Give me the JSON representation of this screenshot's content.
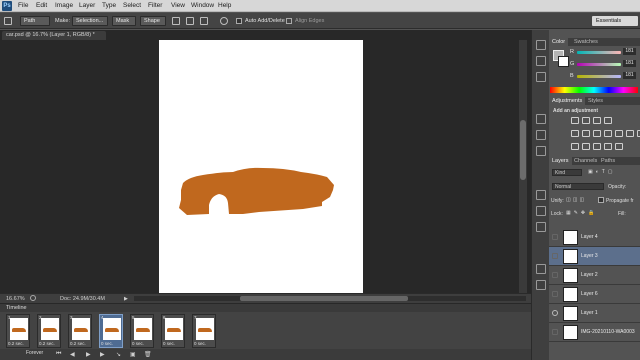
{
  "menubar": {
    "logo": "Ps",
    "items": [
      "File",
      "Edit",
      "Image",
      "Layer",
      "Type",
      "Select",
      "Filter",
      "View",
      "Window",
      "Help"
    ]
  },
  "options_bar": {
    "mode": "Path",
    "make_label": "Make:",
    "selection": "Selection...",
    "mask": "Mask",
    "shape": "Shape",
    "auto_add_delete": "Auto Add/Delete",
    "align_edges": "Align Edges",
    "workspace": "Essentials"
  },
  "document": {
    "tab_title": "car.psd @ 16.7% (Layer 1, RGB/8) *",
    "zoom": "16.67%",
    "doc_size": "Doc: 24.9M/30.4M"
  },
  "timeline": {
    "title": "Timeline",
    "frames": [
      {
        "num": "1",
        "duration": "0.2 sec."
      },
      {
        "num": "2",
        "duration": "0.2 sec."
      },
      {
        "num": "3",
        "duration": "0.2 sec."
      },
      {
        "num": "4",
        "duration": "0 sec."
      },
      {
        "num": "5",
        "duration": "0 sec."
      },
      {
        "num": "6",
        "duration": "0 sec."
      },
      {
        "num": "7",
        "duration": "0 sec."
      }
    ],
    "loop": "Forever"
  },
  "color_panel": {
    "tabs": [
      "Color",
      "Swatches"
    ],
    "channels": [
      {
        "label": "R",
        "value": "181"
      },
      {
        "label": "G",
        "value": "181"
      },
      {
        "label": "B",
        "value": "181"
      }
    ]
  },
  "adjustments_panel": {
    "tabs": [
      "Adjustments",
      "Styles"
    ],
    "heading": "Add an adjustment"
  },
  "layers_panel": {
    "tabs": [
      "Layers",
      "Channels",
      "Paths"
    ],
    "kind": "Kind",
    "blend_mode": "Normal",
    "opacity_label": "Opacity:",
    "lock_label": "Lock:",
    "fill_label": "Fill:",
    "unify_label": "Unify:",
    "propagate_label": "Propagate fr",
    "layers": [
      {
        "name": "Layer 4",
        "selected": false,
        "visible": false
      },
      {
        "name": "Layer 3",
        "selected": true,
        "visible": false
      },
      {
        "name": "Layer 2",
        "selected": false,
        "visible": false
      },
      {
        "name": "Layer 6",
        "selected": false,
        "visible": false
      },
      {
        "name": "Layer 1",
        "selected": false,
        "visible": true
      },
      {
        "name": "IMG-20210110-WA0003",
        "selected": false,
        "visible": false
      }
    ]
  },
  "colors": {
    "car": "#c0681e",
    "selection": "#5c6f8c"
  }
}
